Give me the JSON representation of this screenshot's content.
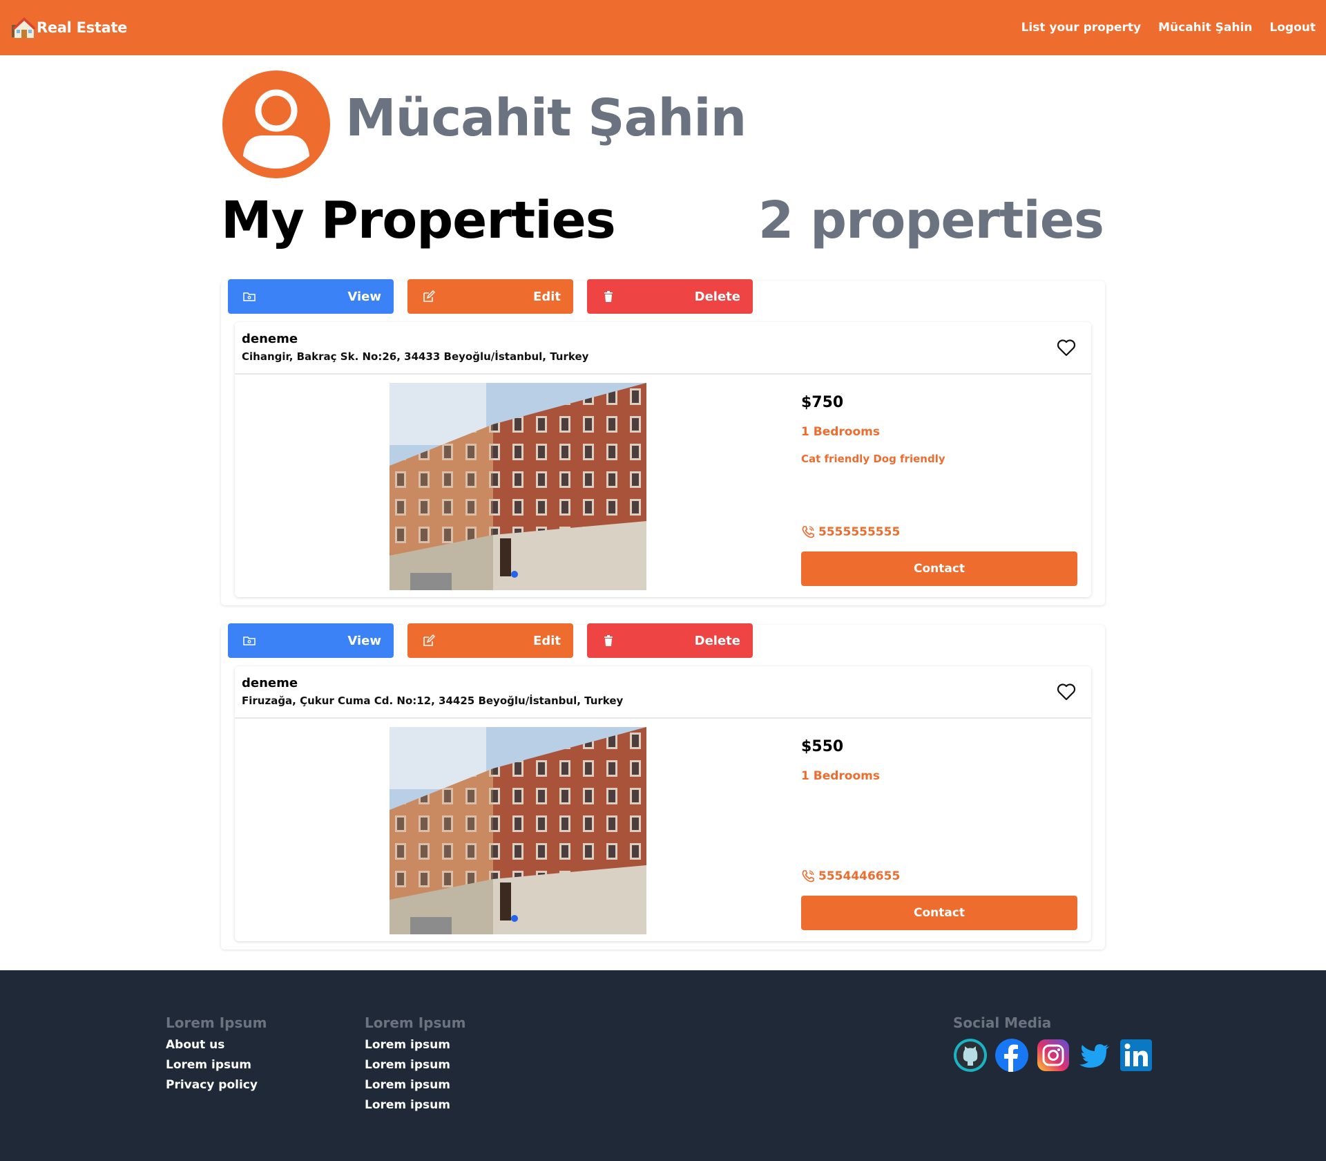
{
  "navbar": {
    "brand": "Real Estate",
    "links": [
      "List your property",
      "Mücahit Şahin",
      "Logout"
    ]
  },
  "profile": {
    "name": "Mücahit Şahin"
  },
  "section": {
    "title": "My Properties",
    "count": "2 properties"
  },
  "listings": [
    {
      "actions": {
        "view": "View",
        "edit": "Edit",
        "delete": "Delete"
      },
      "title": "deneme",
      "address": "Cihangir, Bakraç Sk. No:26, 34433 Beyoğlu/İstanbul, Turkey",
      "price": "$750",
      "bedrooms": "1 Bedrooms",
      "pets": "Cat friendly Dog friendly",
      "phone": "5555555555",
      "contact": "Contact"
    },
    {
      "actions": {
        "view": "View",
        "edit": "Edit",
        "delete": "Delete"
      },
      "title": "deneme",
      "address": "Firuzağa, Çukur Cuma Cd. No:12, 34425 Beyoğlu/İstanbul, Turkey",
      "price": "$550",
      "bedrooms": "1 Bedrooms",
      "pets": "",
      "phone": "5554446655",
      "contact": "Contact"
    }
  ],
  "footer": {
    "col1": {
      "heading": "Lorem Ipsum",
      "links": [
        "About us",
        "Lorem ipsum",
        "Privacy policy"
      ]
    },
    "col2": {
      "heading": "Lorem Ipsum",
      "links": [
        "Lorem ipsum",
        "Lorem ipsum",
        "Lorem ipsum",
        "Lorem ipsum"
      ]
    },
    "social": {
      "heading": "Social Media",
      "icons": [
        "github-icon",
        "facebook-icon",
        "instagram-icon",
        "twitter-icon",
        "linkedin-icon"
      ]
    }
  },
  "colors": {
    "accent": "#ee6c2e",
    "view": "#3b82f6",
    "delete": "#ef4444",
    "heading_gray": "#6b7280",
    "footer_bg": "#1f2937"
  }
}
